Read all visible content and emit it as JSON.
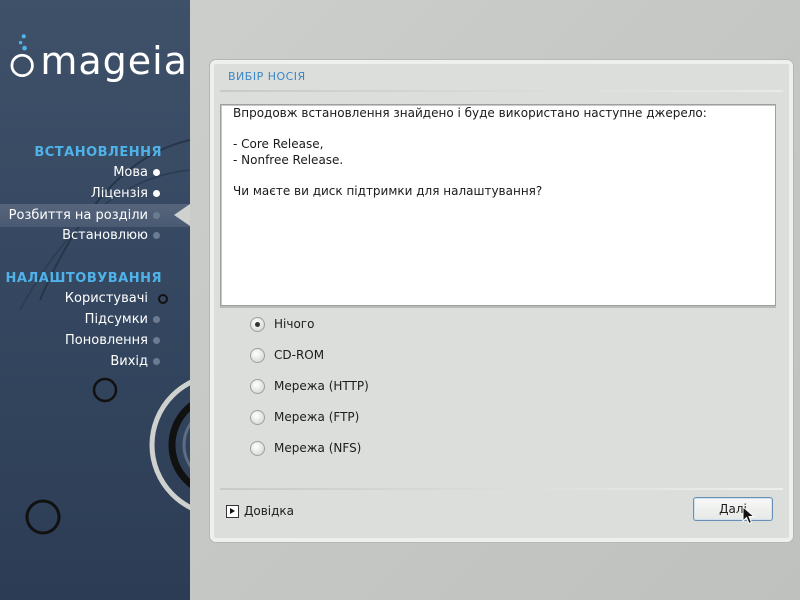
{
  "brand": {
    "logo_text": "mageia"
  },
  "sidebar": {
    "sections": [
      {
        "heading": "ВСТАНОВЛЕННЯ",
        "steps": [
          {
            "label": "Мова",
            "state": "done"
          },
          {
            "label": "Ліцензія",
            "state": "done"
          },
          {
            "label": "Розбиття на розділи",
            "state": "current"
          },
          {
            "label": "Встановлюю",
            "state": "todo"
          }
        ]
      },
      {
        "heading": "НАЛАШТОВУВАННЯ",
        "steps": [
          {
            "label": "Користувачі",
            "state": "todo"
          },
          {
            "label": "Підсумки",
            "state": "todo"
          },
          {
            "label": "Поновлення",
            "state": "todo"
          },
          {
            "label": "Вихід",
            "state": "todo"
          }
        ]
      }
    ]
  },
  "dialog": {
    "title": "ВИБІР НОСІЯ",
    "message_lines": [
      "Впродовж встановлення знайдено і буде використано наступне джерело:",
      "",
      "- Core Release,",
      "- Nonfree Release.",
      "",
      "Чи маєте ви диск підтримки для налаштування?"
    ],
    "options": [
      {
        "label": "Нічого",
        "checked": true
      },
      {
        "label": "CD-ROM",
        "checked": false
      },
      {
        "label": "Мережа (HTTP)",
        "checked": false
      },
      {
        "label": "Мережа (FTP)",
        "checked": false
      },
      {
        "label": "Мережа (NFS)",
        "checked": false
      }
    ],
    "help_label": "Довідка",
    "next_label": "Далі"
  },
  "colors": {
    "accent": "#4fb3ea",
    "title": "#3b86c6",
    "sidebar_bg": "#3a4c64"
  }
}
